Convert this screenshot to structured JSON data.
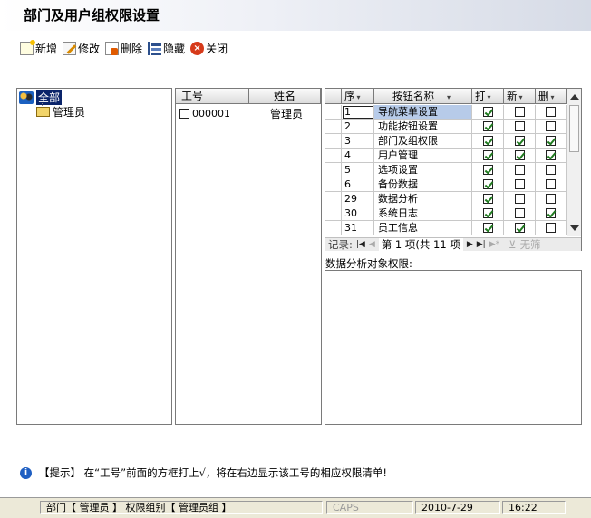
{
  "window": {
    "title": "部门及用户组权限设置"
  },
  "toolbar": {
    "new_label": "新增",
    "edit_label": "修改",
    "delete_label": "删除",
    "hide_label": "隐藏",
    "close_label": "关闭"
  },
  "tree": {
    "root_label": "全部",
    "child_label": "管理员"
  },
  "employees": {
    "columns": [
      "工号",
      "姓名"
    ],
    "rows": [
      {
        "id": "000001",
        "name": "管理员",
        "checked": false
      }
    ]
  },
  "permissions": {
    "columns": [
      "序",
      "按钮名称",
      "打",
      "新",
      "删"
    ],
    "rows": [
      {
        "seq": "1",
        "name": "导航菜单设置",
        "open": true,
        "add": false,
        "del": false
      },
      {
        "seq": "2",
        "name": "功能按钮设置",
        "open": true,
        "add": false,
        "del": false
      },
      {
        "seq": "3",
        "name": "部门及组权限",
        "open": true,
        "add": true,
        "del": true
      },
      {
        "seq": "4",
        "name": "用户管理",
        "open": true,
        "add": true,
        "del": true
      },
      {
        "seq": "5",
        "name": "选项设置",
        "open": true,
        "add": false,
        "del": false
      },
      {
        "seq": "6",
        "name": "备份数据",
        "open": true,
        "add": false,
        "del": false
      },
      {
        "seq": "29",
        "name": "数据分析",
        "open": true,
        "add": false,
        "del": false
      },
      {
        "seq": "30",
        "name": "系统日志",
        "open": true,
        "add": false,
        "del": true
      },
      {
        "seq": "31",
        "name": "员工信息",
        "open": true,
        "add": true,
        "del": false
      }
    ],
    "navigator": {
      "record_label": "记录:",
      "position_text": "第 1 项(共 11 项",
      "filter_label": "无筛"
    }
  },
  "scope": {
    "label": "数据分析对象权限:"
  },
  "hint": {
    "text": "【提示】 在“工号”前面的方框打上√，将在右边显示该工号的相应权限清单!"
  },
  "statusbar": {
    "department": "部门【 管理员 】 权限组别【 管理员组 】",
    "caps": "CAPS",
    "date": "2010-7-29",
    "time": "16:22"
  }
}
